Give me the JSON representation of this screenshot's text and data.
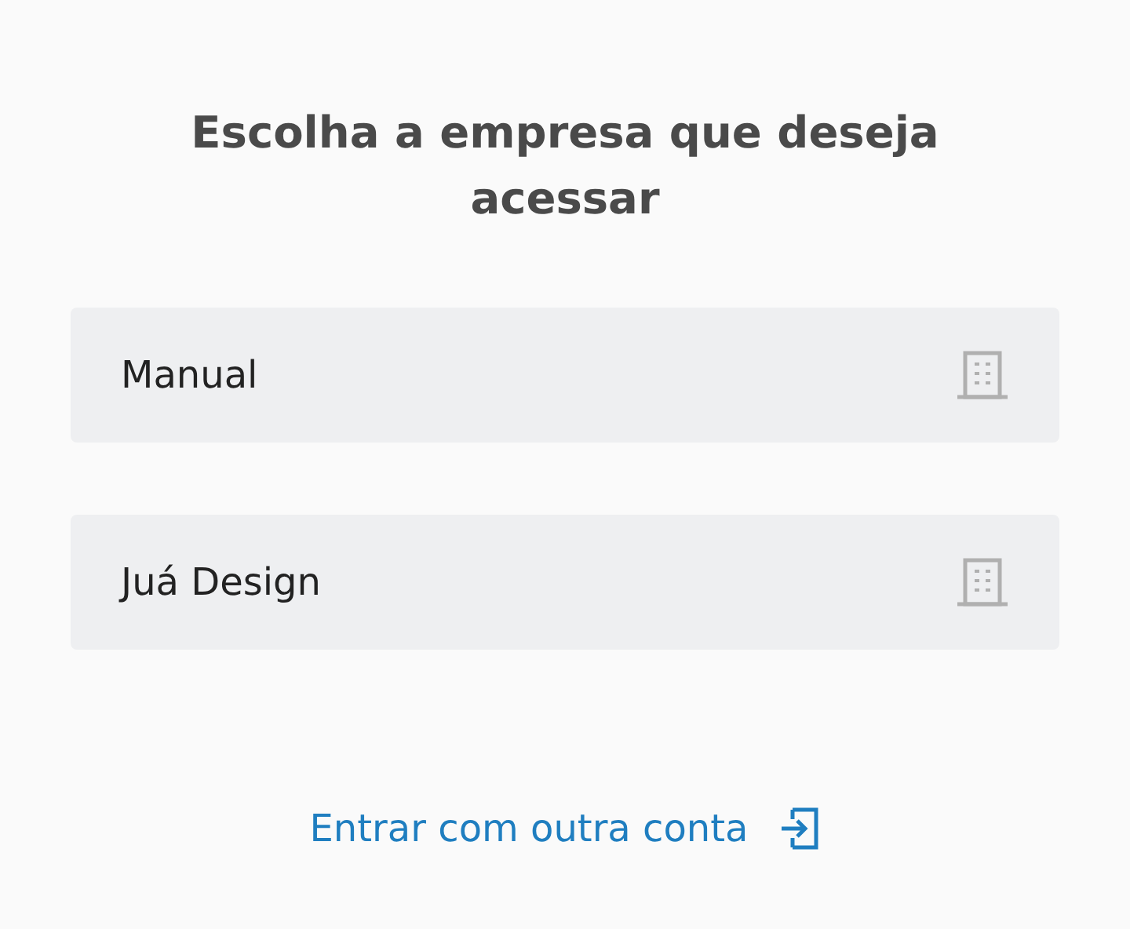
{
  "title": "Escolha a empresa que deseja acessar",
  "companies": [
    {
      "name": "Manual"
    },
    {
      "name": "Juá Design"
    }
  ],
  "other_account_link": "Entrar com outra conta"
}
